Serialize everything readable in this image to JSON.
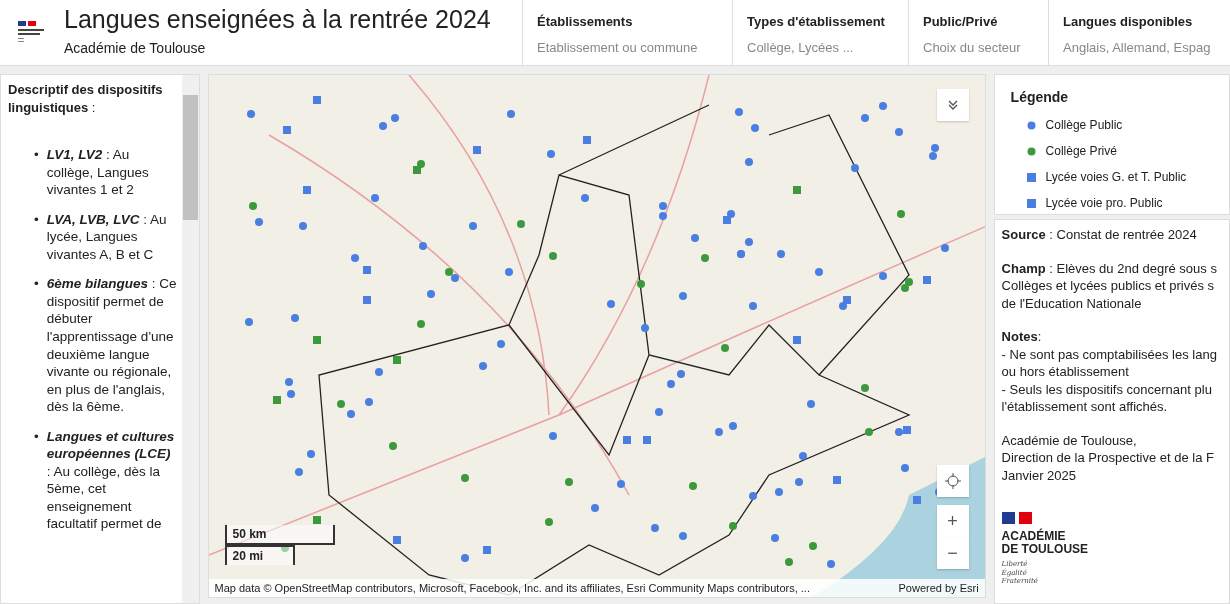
{
  "header": {
    "title": "Langues enseignées à la rentrée 2024",
    "subtitle": "Académie de Toulouse",
    "filters": [
      {
        "label": "Établissements",
        "placeholder": "Etablissement ou commune"
      },
      {
        "label": "Types d'établissement",
        "placeholder": "Collège, Lycées ..."
      },
      {
        "label": "Public/Privé",
        "placeholder": "Choix du secteur"
      },
      {
        "label": "Langues disponibles",
        "placeholder": "Anglais, Allemand, Espag"
      }
    ]
  },
  "description": {
    "heading": "**Descriptif des dispositifs linguistiques** :",
    "items": [
      {
        "marker": "•",
        "term": "LV1, LV2",
        "text": " : Au collège, Langues vivantes 1 et 2"
      },
      {
        "marker": "•",
        "term": "LVA, LVB, LVC",
        "text": " : Au lycée, Langues vivantes A, B et C"
      },
      {
        "marker": "•",
        "term": "6ème bilangues",
        "text": " : Ce dispositif permet de débuter l'apprentissage d'une deuxième langue vivante ou régionale, en plus de l'anglais, dès la 6ème."
      },
      {
        "marker": "•",
        "term": "Langues et cultures européennes (LCE)",
        "text": " : Au collège, dès la 5ème, cet enseignement facultatif permet de"
      }
    ]
  },
  "map": {
    "scale": [
      "50 km",
      "20 mi"
    ],
    "attribution": "Map data © OpenStreetMap contributors, Microsoft, Facebook, Inc. and its affiliates, Esri Community Maps contributors, ...",
    "powered_by": "Powered by Esri",
    "zoom_in": "+",
    "zoom_out": "−"
  },
  "legend": {
    "title": "Légende",
    "items": [
      {
        "label": "Collège Public",
        "kind": "circle",
        "color": "#4a7ee0"
      },
      {
        "label": "Collège Privé",
        "kind": "circle",
        "color": "#3c9a3c"
      },
      {
        "label": "Lycée voies G. et T. Public",
        "kind": "square",
        "color": "#4a7ee0"
      },
      {
        "label": "Lycée voie pro. Public",
        "kind": "square",
        "color": "#4a7ee0"
      }
    ]
  },
  "info": {
    "paragraphs": [
      [
        "**Source** : Constat de rentrée 2024"
      ],
      [
        "**Champ** : Elèves du 2nd degré sous s",
        "Collèges et lycées publics et privés s",
        "de l'Education Nationale"
      ],
      [
        "**Notes**:",
        "- Ne sont pas comptabilisées les lang",
        "ou hors établissement",
        "- Seuls les dispositifs concernant plu",
        "l'établissement sont affichés."
      ],
      [
        "Académie de Toulouse,",
        "Direction de la Prospective et de la F",
        "Janvier 2025"
      ]
    ],
    "logo": {
      "name_lines": [
        "ACADÉMIE",
        "DE TOULOUSE"
      ],
      "motto": [
        "Liberté",
        "Égalité",
        "Fraternité"
      ]
    }
  }
}
